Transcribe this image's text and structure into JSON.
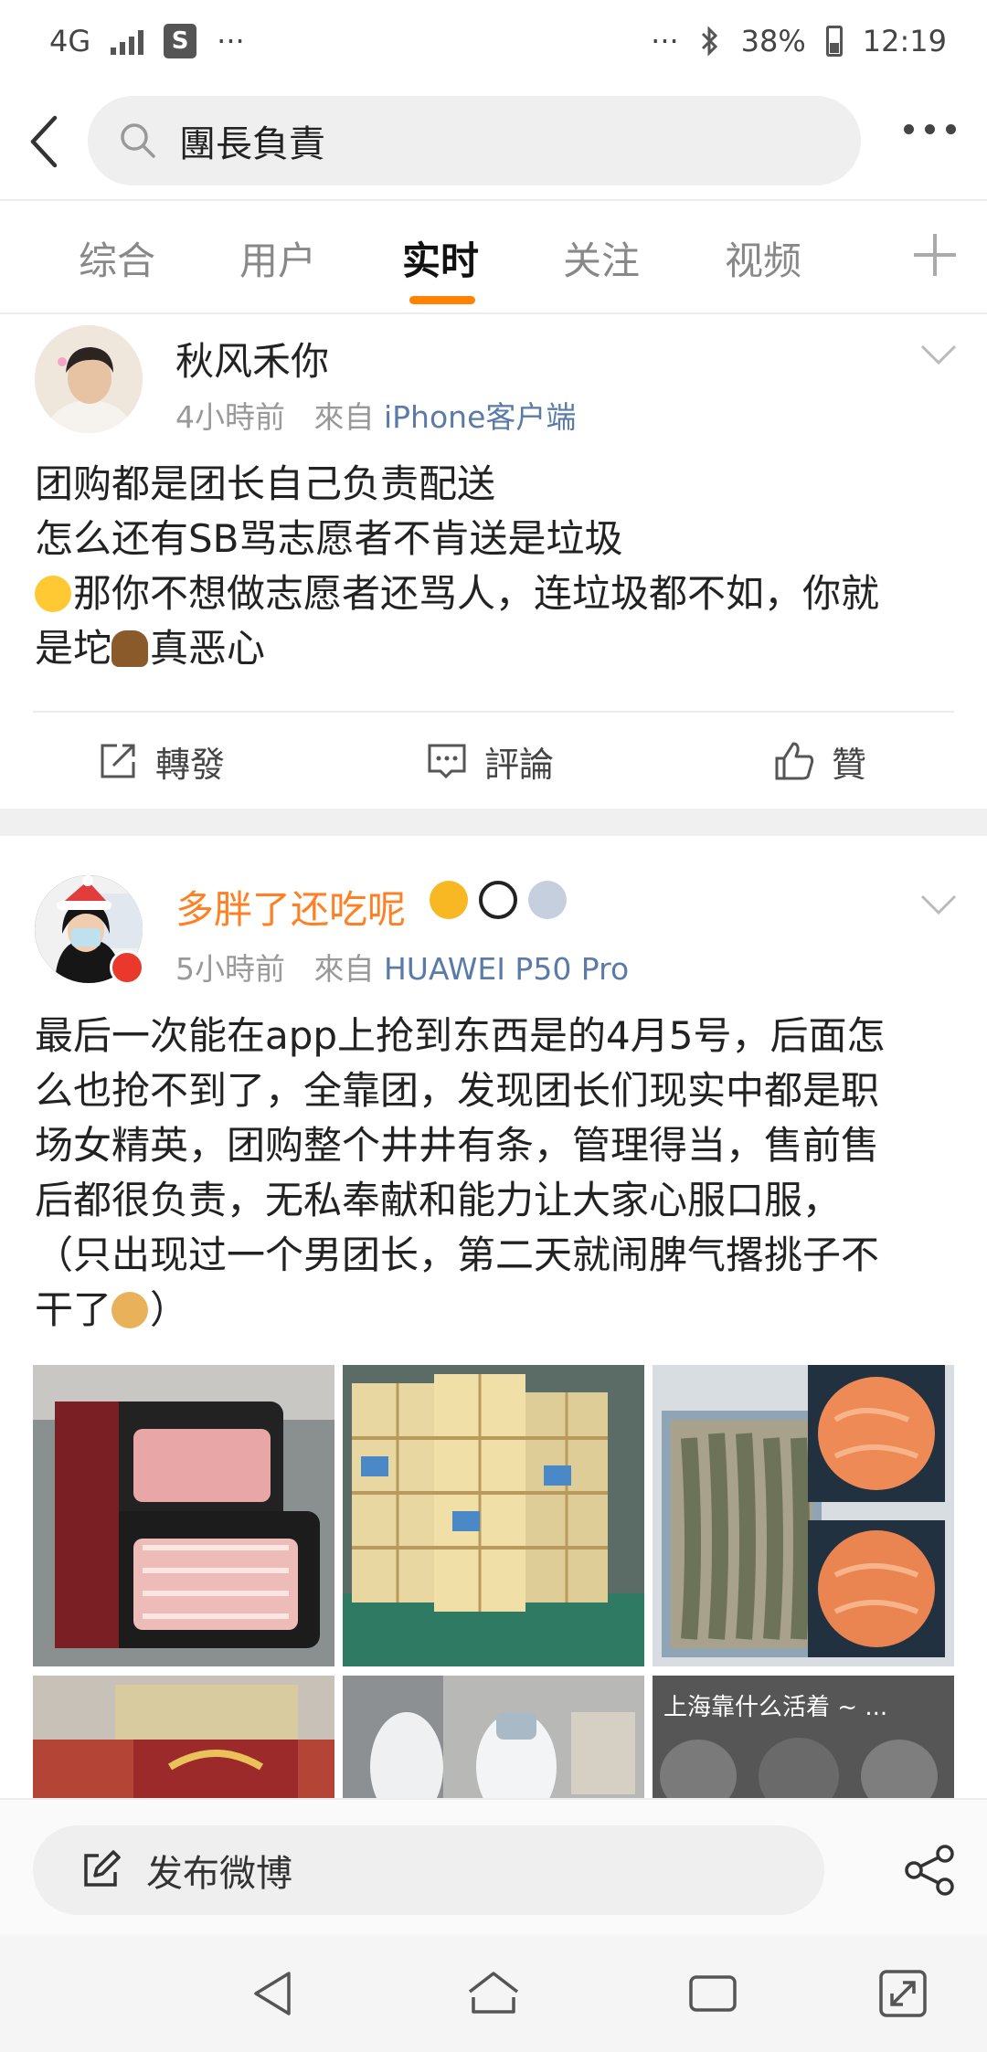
{
  "status_bar": {
    "network": "4G",
    "shop_glyph": "S",
    "left_dots": "···",
    "right_dots": "···",
    "battery": "38%",
    "time": "12:19"
  },
  "header": {
    "search_query": "團長負責"
  },
  "tabs": [
    {
      "label": "综合",
      "active": false
    },
    {
      "label": "用户",
      "active": false
    },
    {
      "label": "实时",
      "active": true
    },
    {
      "label": "关注",
      "active": false
    },
    {
      "label": "视频",
      "active": false
    }
  ],
  "posts": [
    {
      "username": "秋风禾你",
      "time": "4小時前",
      "source_prefix": "來自",
      "source": "iPhone客户端",
      "lines": [
        "团购都是团长自己负责配送",
        "怎么还有SB骂志愿者不肯送是垃圾",
        "那你不想做志愿者还骂人，连垃圾都不如，你就",
        "是坨",
        "真恶心"
      ],
      "actions": {
        "repost": "轉發",
        "comment": "評論",
        "like": "贊"
      }
    },
    {
      "username": "多胖了还吃呢",
      "time": "5小時前",
      "source_prefix": "來自",
      "source": "HUAWEI P50 Pro",
      "lines": [
        "最后一次能在app上抢到东西是的4月5号，后面怎",
        "么也抢不到了，全靠团，发现团长们现实中都是职",
        "场女精英，团购整个井井有条，管理得当，售前售",
        "后都很负责，无私奉献和能力让大家心服口服，",
        "（只出现过一个男团长，第二天就闹脾气撂挑子不",
        "干了",
        "）"
      ],
      "image_caption": "上海靠什么活着 ~ ..."
    }
  ],
  "compose": {
    "label": "发布微博"
  },
  "colors": {
    "accent": "#ff8200",
    "link": "#5a7ba8",
    "username_highlight": "#ff7f23"
  }
}
